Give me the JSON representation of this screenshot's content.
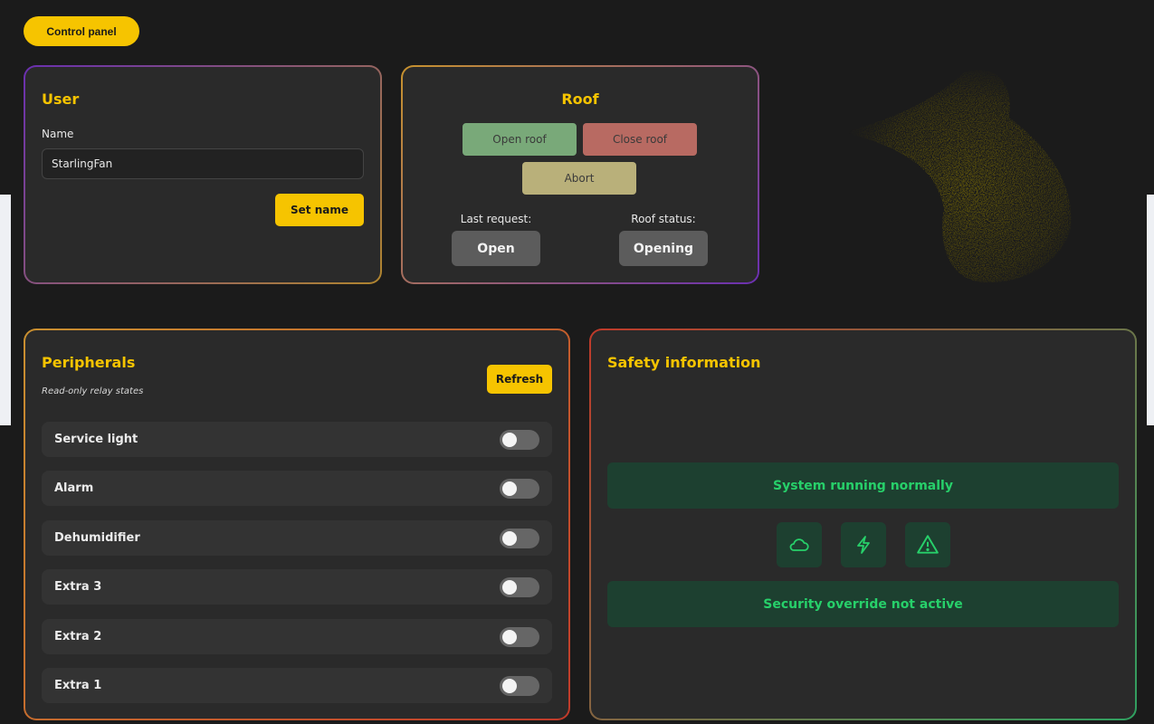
{
  "header": {
    "control_panel_label": "Control panel"
  },
  "user": {
    "title": "User",
    "name_label": "Name",
    "name_value": "StarlingFan",
    "set_name_label": "Set name"
  },
  "roof": {
    "title": "Roof",
    "open_label": "Open roof",
    "close_label": "Close roof",
    "abort_label": "Abort",
    "last_request_label": "Last request:",
    "last_request_value": "Open",
    "roof_status_label": "Roof status:",
    "roof_status_value": "Opening",
    "colors": {
      "open": "#79a979",
      "close": "#b86a62",
      "abort": "#b9b07a"
    }
  },
  "peripherals": {
    "title": "Peripherals",
    "subtitle": "Read-only relay states",
    "refresh_label": "Refresh",
    "relays": [
      {
        "name": "Service light",
        "state": "off"
      },
      {
        "name": "Alarm",
        "state": "off"
      },
      {
        "name": "Dehumidifier",
        "state": "off"
      },
      {
        "name": "Extra 3",
        "state": "off"
      },
      {
        "name": "Extra 2",
        "state": "off"
      },
      {
        "name": "Extra 1",
        "state": "off"
      }
    ]
  },
  "safety": {
    "title": "Safety information",
    "status_text": "System running normally",
    "override_text": "Security override not active",
    "icons": [
      "cloud-icon",
      "lightning-icon",
      "warning-icon"
    ],
    "accent_color": "#27d06a"
  },
  "colors": {
    "accent": "#f6c400",
    "background": "#1b1b1b",
    "card": "#2a2a2a"
  }
}
